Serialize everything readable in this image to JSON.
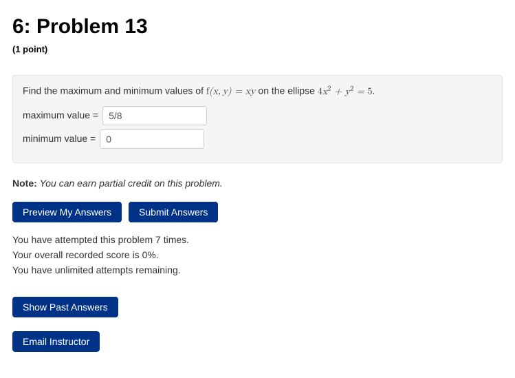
{
  "header": {
    "title": "6: Problem 13",
    "points": "(1 point)"
  },
  "problem": {
    "intro": "Find the maximum and minimum values of ",
    "func_lhs": "f(x, y) = xy",
    "mid": " on the ellipse ",
    "constraint_html": "4x² + y² = 5",
    "end": ".",
    "max_label": "maximum value =",
    "max_value": "5/8",
    "min_label": "minimum value =",
    "min_value": "0"
  },
  "note": {
    "bold": "Note:",
    "italic": "You can earn partial credit on this problem."
  },
  "buttons": {
    "preview": "Preview My Answers",
    "submit": "Submit Answers",
    "past": "Show Past Answers",
    "email": "Email Instructor"
  },
  "status": {
    "attempts": "You have attempted this problem 7 times.",
    "score": "Your overall recorded score is 0%.",
    "remaining": "You have unlimited attempts remaining."
  }
}
